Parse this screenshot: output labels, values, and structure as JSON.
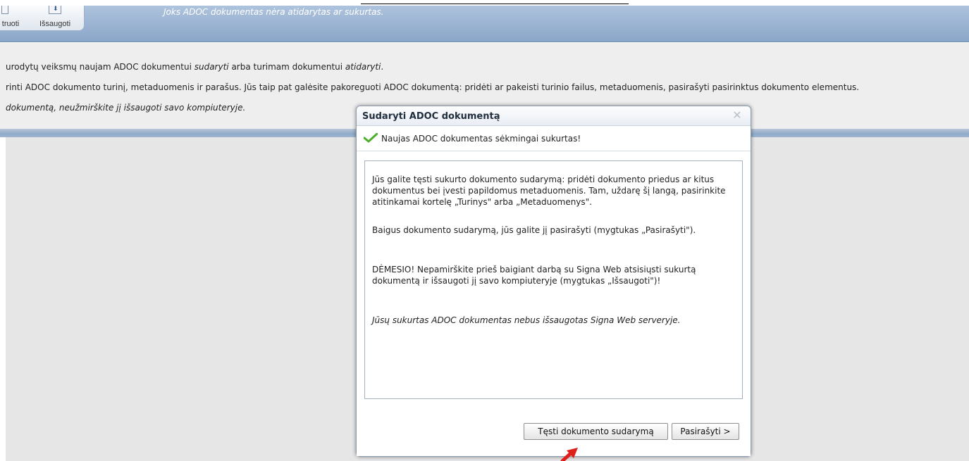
{
  "toolbar": {
    "redaguoti_label": "truoti",
    "issaugoti_label": "Išsaugoti",
    "status": "Joks ADOC dokumentas nėra atidarytas ar sukurtas."
  },
  "info": {
    "line1_a": "urodytų veiksmų naujam ADOC dokumentui ",
    "line1_b": "sudaryti",
    "line1_c": " arba turimam dokumentui ",
    "line1_d": "atidaryti",
    "line1_e": ".",
    "line2": "rinti ADOC dokumento turinį, metaduomenis ir parašus. Jūs taip pat galėsite pakoreguoti ADOC dokumentą: pridėti ar pakeisti turinio failus, metaduomenis, pasirašyti pasirinktus dokumento elementus.",
    "line3": "dokumentą, neužmirškite jį išsaugoti savo kompiuteryje."
  },
  "dialog": {
    "title": "Sudaryti ADOC dokumentą",
    "close_icon": "close-icon",
    "success": "Naujas ADOC dokumentas sėkmingai sukurtas!",
    "p1": "Jūs galite tęsti sukurto dokumento sudarymą: pridėti dokumento priedus ar kitus dokumentus bei įvesti papildomus metaduomenis. Tam, uždarę šį langą, pasirinkite atitinkamai kortelę „Turinys\" arba „Metaduomenys\".",
    "p2": "Baigus dokumento sudarymą, jūs galite jį pasirašyti (mygtukas „Pasirašyti\").",
    "p3": "DĖMESIO! Nepamirškite prieš baigiant darbą su Signa Web atsisiųsti sukurtą dokumentą ir išsaugoti jį savo kompiuteryje (mygtukas „Išsaugoti\")!",
    "p4": "Jūsų sukurtas ADOC dokumentas nebus išsaugotas Signa Web serveryje.",
    "btn_continue": "Tęsti dokumento sudarymą",
    "btn_sign": "Pasirašyti >"
  },
  "colors": {
    "header_gradient_top": "#aec3dd",
    "header_gradient_bottom": "#8aa6c8",
    "check_green": "#4caf2a",
    "annotation_arrow": "#e0201b"
  }
}
